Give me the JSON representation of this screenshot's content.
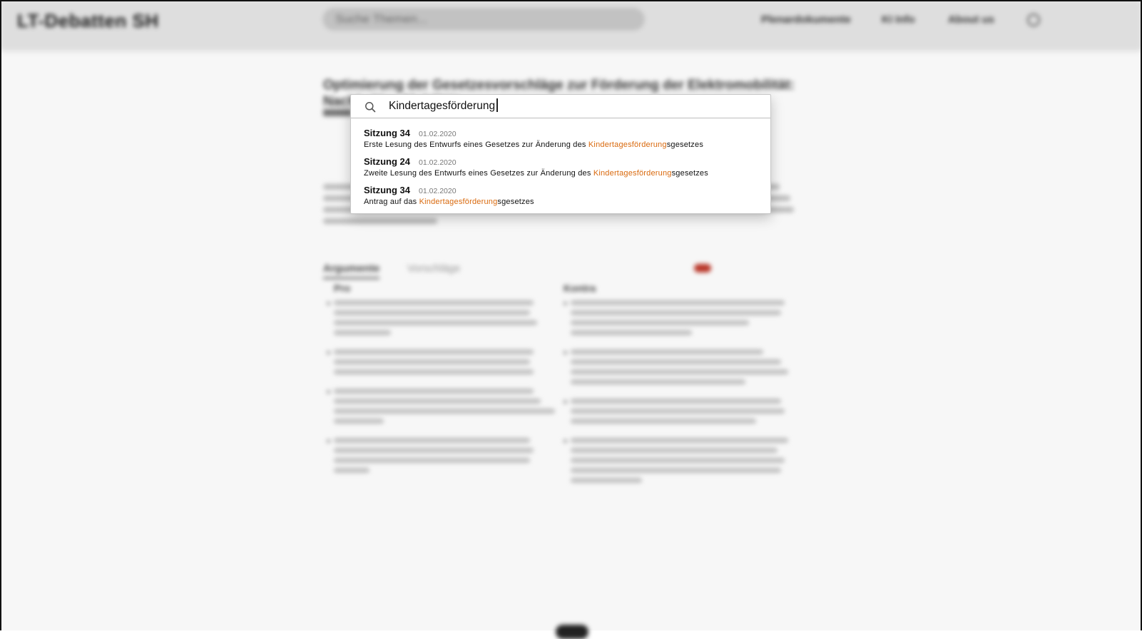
{
  "header": {
    "brand": "LT-Debatten SH",
    "search_placeholder": "Suche Themen...",
    "nav": [
      "Plenardokumente",
      "KI Info",
      "About us"
    ]
  },
  "article": {
    "title": "Optimierung der Gesetzesvorschläge zur Förderung der Elektromobilität: Nachhaltige Mobilität"
  },
  "tabs": [
    "Argumente",
    "Vorschläge"
  ],
  "columns": [
    "Pro",
    "Kontra"
  ],
  "search_modal": {
    "query": "Kindertagesförderung",
    "results": [
      {
        "session": "Sitzung 34",
        "date": "01.02.2020",
        "prefix": "Erste Lesung des Entwurfs eines Gesetzes zur Änderung des ",
        "highlight": "Kindertagesförderung",
        "suffix": "sgesetzes"
      },
      {
        "session": "Sitzung 24",
        "date": "01.02.2020",
        "prefix": "Zweite Lesung des Entwurfs eines Gesetzes zur Änderung des ",
        "highlight": "Kindertagesförderung",
        "suffix": "sgesetzes"
      },
      {
        "session": "Sitzung 34",
        "date": "01.02.2020",
        "prefix": "Antrag auf das ",
        "highlight": "Kindertagesförderung",
        "suffix": "sgesetzes"
      }
    ]
  },
  "colors": {
    "highlight": "#d9690d",
    "header_bg": "#e6e6e6",
    "toggle": "#c0392b"
  },
  "icons": [
    "search-icon",
    "settings-icon"
  ]
}
